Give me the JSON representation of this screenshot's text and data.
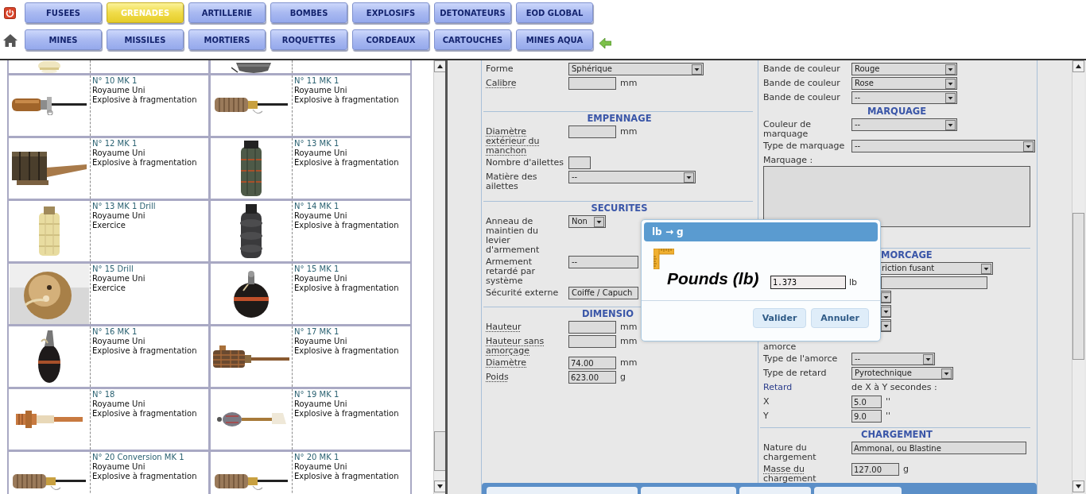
{
  "nav": {
    "rows": [
      {
        "buttons": [
          {
            "label": "FUSEES",
            "selected": false
          },
          {
            "label": "GRENADES",
            "selected": true
          },
          {
            "label": "ARTILLERIE",
            "selected": false
          },
          {
            "label": "BOMBES",
            "selected": false
          },
          {
            "label": "EXPLOSIFS",
            "selected": false
          },
          {
            "label": "DETONATEURS",
            "selected": false
          },
          {
            "label": "EOD GLOBAL",
            "selected": false
          }
        ]
      },
      {
        "buttons": [
          {
            "label": "MINES",
            "selected": false
          },
          {
            "label": "MISSILES",
            "selected": false
          },
          {
            "label": "MORTIERS",
            "selected": false
          },
          {
            "label": "ROQUETTES",
            "selected": false
          },
          {
            "label": "CORDEAUX",
            "selected": false
          },
          {
            "label": "CARTOUCHES",
            "selected": false
          },
          {
            "label": "MINES AQUA",
            "selected": false
          }
        ]
      }
    ]
  },
  "catalog": {
    "rows": [
      {
        "cells": [
          {
            "image": {
              "kind": "picture"
            }
          },
          {
            "image": {
              "kind": "picture"
            }
          }
        ]
      },
      {
        "cells": [
          {
            "image": {
              "kind": "picture"
            },
            "name": "N° 10 MK 1",
            "country": "Royaume Uni",
            "category": "Explosive à fragmentation"
          },
          {
            "image": {
              "kind": "picture"
            },
            "name": "N° 11 MK 1",
            "country": "Royaume Uni",
            "category": "Explosive à fragmentation"
          }
        ]
      },
      {
        "cells": [
          {
            "image": {
              "kind": "picture"
            },
            "name": "N° 12 MK 1",
            "country": "Royaume Uni",
            "category": "Explosive à fragmentation"
          },
          {
            "image": {
              "kind": "picture"
            },
            "name": "N° 13 MK 1",
            "country": "Royaume Uni",
            "category": "Explosive à fragmentation"
          }
        ]
      },
      {
        "cells": [
          {
            "image": {
              "kind": "picture"
            },
            "name": "N° 13 MK 1 Drill",
            "country": "Royaume Uni",
            "category": "Exercice"
          },
          {
            "image": {
              "kind": "picture"
            },
            "name": "N° 14 MK 1",
            "country": "Royaume Uni",
            "category": "Explosive à fragmentation"
          }
        ]
      },
      {
        "cells": [
          {
            "image": {
              "kind": "picture"
            },
            "name": "N° 15 Drill",
            "country": "Royaume Uni",
            "category": "Exercice"
          },
          {
            "image": {
              "kind": "picture"
            },
            "name": "N° 15 MK 1",
            "country": "Royaume Uni",
            "category": "Explosive à fragmentation"
          }
        ]
      },
      {
        "cells": [
          {
            "image": {
              "kind": "picture"
            },
            "name": "N° 16 MK 1",
            "country": "Royaume Uni",
            "category": "Explosive à fragmentation"
          },
          {
            "image": {
              "kind": "picture"
            },
            "name": "N° 17 MK 1",
            "country": "Royaume Uni",
            "category": "Explosive à fragmentation"
          }
        ]
      },
      {
        "cells": [
          {
            "image": {
              "kind": "picture"
            },
            "name": "N° 18",
            "country": "Royaume Uni",
            "category": "Explosive à fragmentation"
          },
          {
            "image": {
              "kind": "picture"
            },
            "name": "N° 19 MK 1",
            "country": "Royaume Uni",
            "category": "Explosive à fragmentation"
          }
        ]
      },
      {
        "cells": [
          {
            "image": {
              "kind": "picture"
            },
            "name": "N° 20 Conversion MK 1",
            "country": "Royaume Uni",
            "category": "Explosive à fragmentation"
          },
          {
            "image": {
              "kind": "picture"
            },
            "name": "N° 20 MK 1",
            "country": "Royaume Uni",
            "category": "Explosive à fragmentation"
          }
        ]
      }
    ]
  },
  "form": {
    "columns": [
      {
        "sections": [
          {
            "fields": [
              {
                "label": "Forme",
                "help": false,
                "kind": "select",
                "value": "Sphérique"
              },
              {
                "label": "Calibre",
                "help": true,
                "kind": "input",
                "unit": "mm"
              }
            ]
          },
          {
            "kind": "plain",
            "separator": true,
            "heading": "EMPENNAGE",
            "fields": [
              {
                "label": "Diamètre extérieur du manchon",
                "help": true,
                "kind": "input",
                "unit": "mm"
              },
              {
                "label": "Nombre d'ailettes",
                "help": false,
                "kind": "input"
              },
              {
                "label": "Matière des ailettes",
                "help": false,
                "kind": "select",
                "value": "--"
              }
            ]
          },
          {
            "kind": "plain",
            "separator": true,
            "heading": "SECURITES",
            "fields": [
              {
                "label": "Anneau de maintien du levier d'armement",
                "help": false,
                "kind": "select",
                "value": "Non"
              },
              {
                "label": "Armement retardé par système",
                "help": false,
                "kind": "select-cut",
                "value": "--"
              },
              {
                "label": "Sécurité externe",
                "help": false,
                "kind": "select-cut",
                "value": "Coiffe / Capuch"
              }
            ]
          },
          {
            "kind": "covered",
            "separator": true,
            "heading": "DIMENSIO",
            "fields": [
              {
                "label": "Hauteur",
                "help": true,
                "kind": "input",
                "unit": "mm"
              },
              {
                "label": "Hauteur sans amorçage",
                "help": true,
                "kind": "input",
                "unit": "mm"
              },
              {
                "label": "Diamètre",
                "help": true,
                "kind": "input",
                "value": "74.00",
                "unit": "mm"
              },
              {
                "label": "Poids",
                "help": true,
                "kind": "input",
                "value": "623.00",
                "unit": "g"
              }
            ]
          }
        ]
      },
      {
        "sections": [
          {
            "fields": [
              {
                "label": "Bande de couleur",
                "help": false,
                "kind": "select",
                "value": "Rouge"
              },
              {
                "label": "Bande de couleur",
                "help": false,
                "kind": "select",
                "value": "Rose"
              },
              {
                "label": "Bande de couleur",
                "help": false,
                "kind": "select",
                "value": "--"
              }
            ]
          },
          {
            "kind": "plain",
            "separator": false,
            "heading": "MARQUAGE",
            "fields": [
              {
                "label": "Couleur de marquage",
                "help": false,
                "kind": "select",
                "value": "--"
              },
              {
                "label": "Type de marquage",
                "help": false,
                "kind": "select",
                "value": "--"
              },
              {
                "label": "Marquage :",
                "help": false,
                "kind": "textarea"
              }
            ]
          },
          {
            "kind": "covered",
            "separator": true,
            "heading": "MORCAGE",
            "fields": [
              {
                "kind": "select-stub",
                "value": "riction fusant"
              },
              {
                "kind": "input-stub"
              },
              {
                "kind": "select-stub"
              },
              {
                "kind": "select-stub"
              },
              {
                "label": "amorce",
                "help": false,
                "kind": "select-stub"
              },
              {
                "label": "Type de l'amorce",
                "help": false,
                "kind": "select",
                "value": "--"
              },
              {
                "label": "Type de retard",
                "help": false,
                "kind": "select",
                "value": "Pyrotechnique"
              },
              {
                "label": "Retard",
                "help": false,
                "kind": "note",
                "value": "de X à Y secondes :"
              },
              {
                "label": "X",
                "help": false,
                "kind": "input",
                "value": "5.0",
                "unit": "''"
              },
              {
                "label": "Y",
                "help": false,
                "kind": "input",
                "value": "9.0",
                "unit": "''"
              }
            ]
          },
          {
            "kind": "plain",
            "separator": true,
            "heading": "CHARGEMENT",
            "fields": [
              {
                "label": "Nature du chargement",
                "help": false,
                "kind": "input",
                "value": "Ammonal, ou Blastine"
              },
              {
                "label": "Masse du chargement",
                "help": true,
                "kind": "input",
                "value": "127.00",
                "unit": "g"
              }
            ]
          }
        ]
      }
    ]
  },
  "dialog": {
    "title": "lb → g",
    "heading": "Pounds (lb)",
    "input": {
      "value": "1.373",
      "unit": "lb"
    },
    "buttons": [
      "Valider",
      "Annuler"
    ]
  }
}
